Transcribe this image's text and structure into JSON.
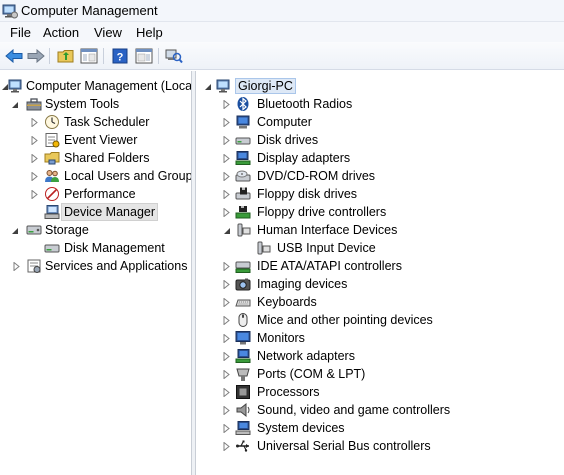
{
  "window": {
    "title": "Computer Management"
  },
  "menu": {
    "file": "File",
    "action": "Action",
    "view": "View",
    "help": "Help"
  },
  "left_tree": {
    "root": "Computer Management (Local",
    "system_tools": "System Tools",
    "task_scheduler": "Task Scheduler",
    "event_viewer": "Event Viewer",
    "shared_folders": "Shared Folders",
    "local_users": "Local Users and Groups",
    "performance": "Performance",
    "device_manager": "Device Manager",
    "storage": "Storage",
    "disk_management": "Disk Management",
    "services": "Services and Applications"
  },
  "right_tree": {
    "root": "Giorgi-PC",
    "items": [
      "Bluetooth Radios",
      "Computer",
      "Disk drives",
      "Display adapters",
      "DVD/CD-ROM drives",
      "Floppy disk drives",
      "Floppy drive controllers",
      "Human Interface Devices",
      "USB Input Device",
      "IDE ATA/ATAPI controllers",
      "Imaging devices",
      "Keyboards",
      "Mice and other pointing devices",
      "Monitors",
      "Network adapters",
      "Ports (COM & LPT)",
      "Processors",
      "Sound, video and game controllers",
      "System devices",
      "Universal Serial Bus controllers"
    ]
  },
  "icons": {
    "computer": "computer-icon",
    "tools": "toolbox-icon",
    "clock": "clock-icon",
    "viewer": "event-viewer-icon",
    "folder": "shared-folder-icon",
    "users": "users-icon",
    "perf": "performance-icon",
    "devmgr": "device-manager-icon",
    "storage": "storage-icon",
    "disk": "disk-icon",
    "services": "services-icon"
  }
}
